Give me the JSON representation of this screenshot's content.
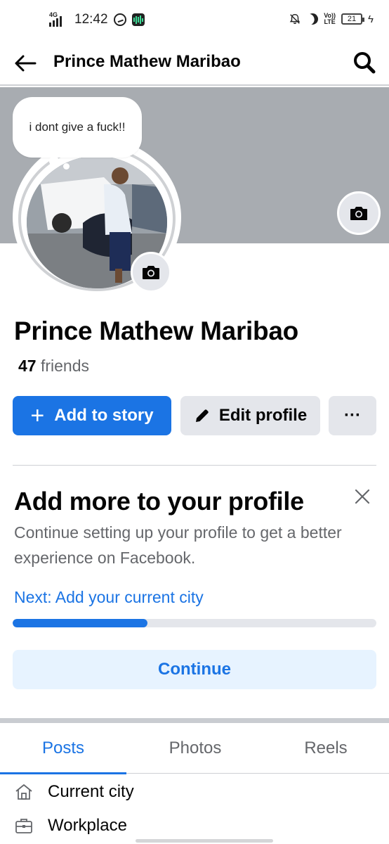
{
  "status_bar": {
    "network": "4G",
    "time": "12:42",
    "lte_label_top": "Vo))",
    "lte_label_bottom": "LTE",
    "battery": "21"
  },
  "app_bar": {
    "title": "Prince Mathew Maribao"
  },
  "profile": {
    "note_bubble": "i dont give a fuck!!",
    "name": "Prince Mathew Maribao",
    "friends_count": "47",
    "friends_label": "friends"
  },
  "actions": {
    "add_story": "Add to story",
    "edit_profile": "Edit profile",
    "more": "···"
  },
  "add_more_card": {
    "title": "Add more to your profile",
    "description": "Continue setting up your profile to get a better experience on Facebook.",
    "next_step": "Next: Add your current city",
    "progress": 0.37,
    "continue_label": "Continue"
  },
  "tabs": [
    {
      "label": "Posts",
      "active": true
    },
    {
      "label": "Photos",
      "active": false
    },
    {
      "label": "Reels",
      "active": false
    }
  ],
  "details": [
    {
      "icon": "home-icon",
      "label": "Current city"
    },
    {
      "icon": "briefcase-icon",
      "label": "Workplace"
    }
  ],
  "colors": {
    "accent": "#1b74e4",
    "secondary_button": "#e4e6eb",
    "cover": "#a8acb1",
    "continue_bg": "#e7f3ff"
  }
}
